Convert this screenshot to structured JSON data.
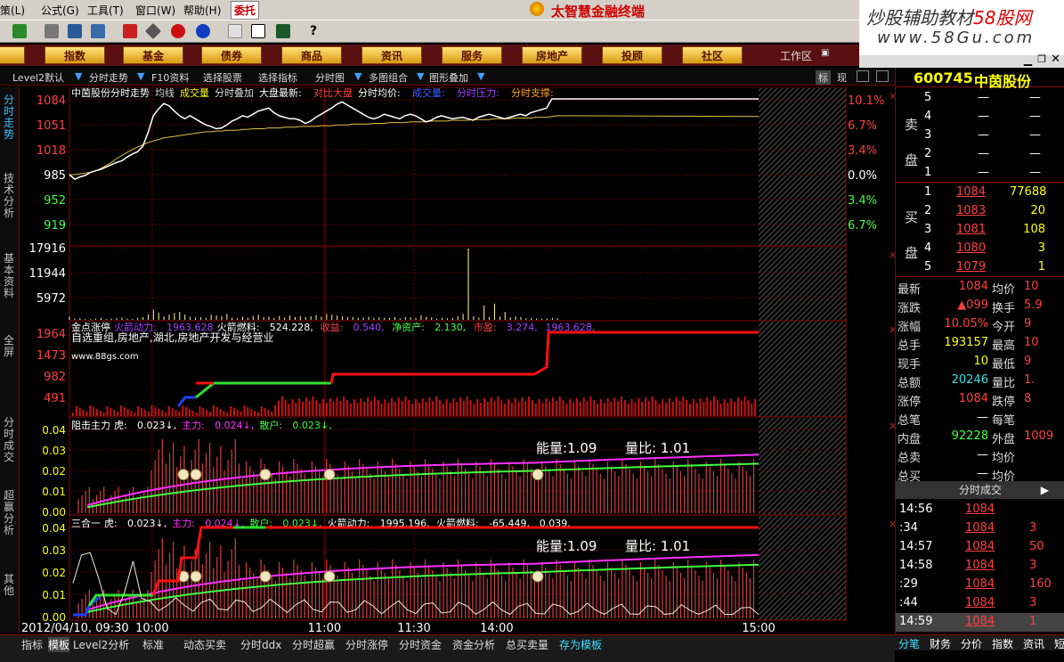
{
  "menu": {
    "items": [
      "策(L)",
      "公式(G)",
      "工具(T)",
      "窗口(W)",
      "帮助(H)"
    ],
    "trade_tab": "委托",
    "app_title": "太智慧金融终端"
  },
  "watermark": {
    "line1": "炒股辅助教材",
    "site_cn": "58股网",
    "line2": "www.58Gu.com"
  },
  "nav": {
    "items": [
      "股",
      "指数",
      "基金",
      "债券",
      "商品",
      "资讯",
      "服务",
      "房地产",
      "投顾",
      "社区"
    ],
    "workspace": "工作区"
  },
  "subtoolbar": {
    "items": [
      "Level2默认",
      "分时走势",
      "F10资料",
      "选择股票",
      "选择指标",
      "分时图",
      "多图组合",
      "图形叠加"
    ],
    "right_labels": [
      "标",
      "现"
    ]
  },
  "left_tabs": [
    "分时走势",
    "技术分析",
    "基本资料",
    "全屏",
    "分时成交",
    "超赢分析",
    "其他"
  ],
  "price_panel": {
    "header": [
      "中茵股份分时走势",
      "均线",
      "成交量",
      "分时叠加",
      "大盘最新:",
      "对比大盘",
      "分时均价:",
      "成交量:",
      "分时压力:",
      "分时支撑:"
    ],
    "y_left": [
      "1084",
      "1051",
      "1018",
      "985",
      "952",
      "919"
    ],
    "y_right": [
      "10.1%",
      "6.7%",
      "3.4%",
      "0.0%",
      "3.4%",
      "6.7%"
    ],
    "price_series": [
      985,
      979,
      982,
      984,
      988,
      990,
      992,
      995,
      998,
      1001,
      1003,
      1008,
      1012,
      1015,
      1022,
      1040,
      1062,
      1071,
      1078,
      1075,
      1068,
      1062,
      1058,
      1062,
      1058,
      1054,
      1050,
      1048,
      1045,
      1046,
      1050,
      1055,
      1058,
      1062,
      1060,
      1064,
      1068,
      1070,
      1072,
      1066,
      1062,
      1060,
      1058,
      1058,
      1056,
      1052,
      1055,
      1060,
      1064,
      1068,
      1072,
      1077,
      1080,
      1076,
      1072,
      1068,
      1064,
      1060,
      1058,
      1060,
      1064,
      1062,
      1060,
      1058,
      1062,
      1064,
      1062,
      1058,
      1054,
      1056,
      1060,
      1062,
      1060,
      1058,
      1059,
      1060,
      1058,
      1056,
      1060,
      1062,
      1064,
      1062,
      1060,
      1058,
      1060,
      1062,
      1064,
      1062,
      1066,
      1068,
      1070,
      1072,
      1084
    ],
    "avg_series": [
      985,
      985,
      986,
      987,
      988,
      990,
      993,
      997,
      1001,
      1006,
      1010,
      1014,
      1018,
      1021,
      1024,
      1027,
      1029,
      1031,
      1033,
      1034,
      1035,
      1036,
      1037,
      1038,
      1039,
      1040,
      1041,
      1041,
      1042,
      1042,
      1043,
      1043,
      1043,
      1044,
      1044,
      1045,
      1045,
      1045,
      1046,
      1046,
      1046,
      1047,
      1047,
      1047,
      1048,
      1048,
      1048,
      1048,
      1049,
      1049,
      1049,
      1050,
      1050,
      1050,
      1051,
      1051,
      1051,
      1051,
      1052,
      1052,
      1052,
      1053,
      1053,
      1053,
      1053,
      1054,
      1054,
      1054,
      1054,
      1055,
      1055,
      1055,
      1055,
      1056,
      1056,
      1056,
      1056,
      1057,
      1057,
      1057,
      1057,
      1058,
      1058,
      1058,
      1058,
      1059,
      1059,
      1059,
      1059,
      1060,
      1060,
      1060,
      1061,
      1062
    ]
  },
  "volume_panel": {
    "y_left": [
      "17916",
      "11944",
      "5972"
    ],
    "vol_series": [
      800,
      300,
      400,
      200,
      150,
      300,
      500,
      200,
      350,
      400,
      600,
      300,
      250,
      500,
      700,
      1400,
      2600,
      1800,
      900,
      1300,
      1700,
      2000,
      1300,
      800,
      600,
      700,
      500,
      1300,
      1100,
      900,
      1500,
      600,
      400,
      800,
      500,
      1000,
      1300,
      700,
      800,
      500,
      1000,
      600,
      1100,
      700,
      900,
      700,
      900,
      1200,
      800,
      1500,
      1300,
      1100,
      900,
      700,
      700,
      500,
      600,
      800,
      500,
      600,
      500,
      500,
      700,
      400,
      700,
      600,
      500,
      1200,
      800,
      600,
      300,
      500,
      400,
      500,
      900,
      1500,
      17916,
      900,
      600,
      3600,
      700,
      4100,
      800,
      2000,
      600,
      900,
      700,
      400,
      500,
      300,
      300,
      300,
      500,
      400
    ]
  },
  "jindian_panel": {
    "header": [
      "金点涨停",
      "火箭动力:",
      "1963.628",
      "火箭燃料:",
      "524.228,",
      "收益:",
      "0.540,",
      "净资产:",
      "2.130,",
      "市盈:",
      "3.274,",
      "1963.628,"
    ],
    "subtitle": "自选重组,房地产,湖北,房地产开发与经营业",
    "site": "www.88gs.com",
    "y_left": [
      "1964",
      "1473",
      "982",
      "491"
    ]
  },
  "zuji_panel": {
    "header": [
      "阻击主力",
      "虎:",
      "0.023↓,",
      "主力:",
      "0.024↓,",
      "散户:",
      "0.023↓,"
    ],
    "y_left": [
      "0.04",
      "0.03",
      "0.02",
      "0.01",
      "0.00"
    ],
    "energy": "能量:1.09",
    "ratio": "量比: 1.01"
  },
  "sanhe_panel": {
    "header": [
      "三合一",
      "虎:",
      "0.023↓,",
      "主力:",
      "0.024↓,",
      "散户:",
      "0.023↓,",
      "火箭动力:",
      "1995.196,",
      "火箭燃料:",
      "-65.449,",
      "0.039,"
    ],
    "y_left": [
      "0.04",
      "0.03",
      "0.02",
      "0.01",
      "0.00"
    ],
    "energy": "能量:1.09",
    "ratio": "量比: 1.01"
  },
  "x_axis": {
    "labels": [
      "2012/04/10, 09:30",
      "10:00",
      "11:00",
      "11:30",
      "14:00",
      "15:00"
    ]
  },
  "quote": {
    "code": "600745",
    "name": "中茵股份",
    "sell_label": "卖盘",
    "buy_label": "买盘",
    "sell": [
      {
        "lvl": "5",
        "price": "—",
        "vol": "—"
      },
      {
        "lvl": "4",
        "price": "—",
        "vol": "—"
      },
      {
        "lvl": "3",
        "price": "—",
        "vol": "—"
      },
      {
        "lvl": "2",
        "price": "—",
        "vol": "—"
      },
      {
        "lvl": "1",
        "price": "—",
        "vol": "—"
      }
    ],
    "buy": [
      {
        "lvl": "1",
        "price": "1084",
        "vol": "77688"
      },
      {
        "lvl": "2",
        "price": "1083",
        "vol": "20"
      },
      {
        "lvl": "3",
        "price": "1081",
        "vol": "108"
      },
      {
        "lvl": "4",
        "price": "1080",
        "vol": "3"
      },
      {
        "lvl": "5",
        "price": "1079",
        "vol": "1"
      }
    ],
    "stats": [
      {
        "k1": "最新",
        "v1": "1084",
        "k2": "均价",
        "v2": "10"
      },
      {
        "k1": "涨跌",
        "v1": "▲099",
        "k2": "换手",
        "v2": "5.9"
      },
      {
        "k1": "涨幅",
        "v1": "10.05%",
        "k2": "今开",
        "v2": "9"
      },
      {
        "k1": "总手",
        "v1": "193157",
        "k2": "最高",
        "v2": "10"
      },
      {
        "k1": "现手",
        "v1": "10",
        "k2": "最低",
        "v2": "9"
      },
      {
        "k1": "总额",
        "v1": "20246",
        "k2": "量比",
        "v2": "1."
      },
      {
        "k1": "涨停",
        "v1": "1084",
        "k2": "跌停",
        "v2": "8"
      },
      {
        "k1": "总笔",
        "v1": "—",
        "k2": "每笔",
        "v2": ""
      },
      {
        "k1": "内盘",
        "v1": "92228",
        "k2": "外盘",
        "v2": "1009"
      },
      {
        "k1": "总卖",
        "v1": "—",
        "k2": "均价",
        "v2": ""
      },
      {
        "k1": "总买",
        "v1": "—",
        "k2": "均价",
        "v2": ""
      }
    ],
    "ticks_title": "分时成交",
    "ticks": [
      {
        "t": "14:56",
        "p": "1084",
        "v": ""
      },
      {
        "t": ":34",
        "p": "1084",
        "v": "3"
      },
      {
        "t": "14:57",
        "p": "1084",
        "v": "50"
      },
      {
        "t": "14:58",
        "p": "1084",
        "v": "3"
      },
      {
        "t": ":29",
        "p": "1084",
        "v": "160"
      },
      {
        "t": ":44",
        "p": "1084",
        "v": "3"
      },
      {
        "t": "14:59",
        "p": "1084",
        "v": "1"
      }
    ]
  },
  "bottom_tabs": [
    "指标",
    "模板",
    "Level2分析",
    "标准",
    "动态买卖",
    "分时ddx",
    "分时超赢",
    "分时涨停",
    "分时资金",
    "资金分析",
    "总买卖量",
    "存为模板"
  ],
  "rp_bottom_tabs": [
    "分笔",
    "财务",
    "分价",
    "指数",
    "资讯",
    "短"
  ]
}
